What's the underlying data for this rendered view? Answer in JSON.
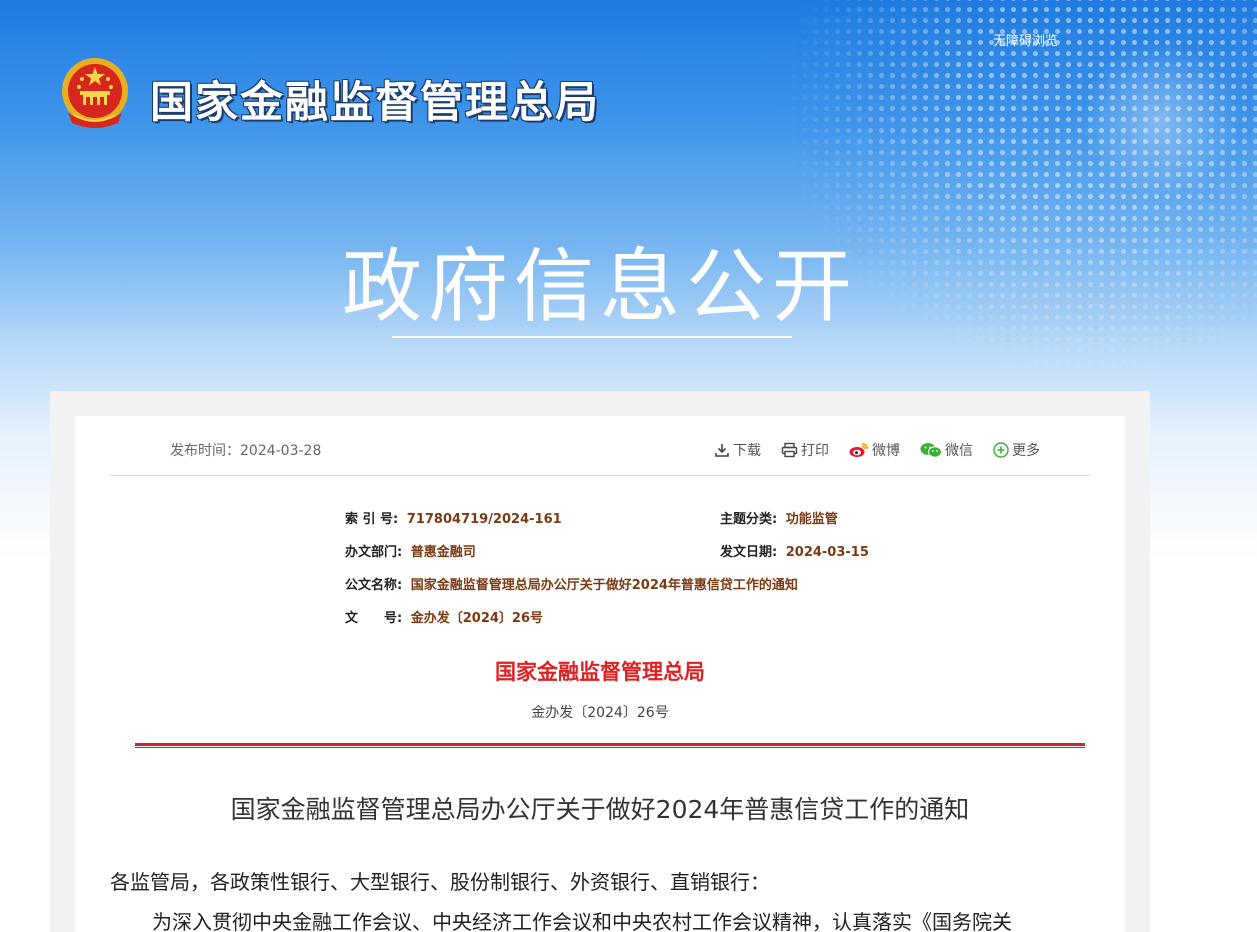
{
  "header": {
    "accessibility_link": "无障碍浏览",
    "org_name": "国家金融监督管理总局",
    "section_title": "政府信息公开"
  },
  "toolbar": {
    "publish_label": "发布时间：2024-03-28",
    "download": "下载",
    "print": "打印",
    "weibo": "微博",
    "wechat": "微信",
    "more": "更多"
  },
  "meta": {
    "index_label": "索 引 号:",
    "index_value": "717804719/2024-161",
    "topic_label": "主题分类:",
    "topic_value": "功能监管",
    "dept_label": "办文部门:",
    "dept_value": "普惠金融司",
    "date_label": "发文日期:",
    "date_value": "2024-03-15",
    "name_label": "公文名称:",
    "name_value": "国家金融监督管理总局办公厅关于做好2024年普惠信贷工作的通知",
    "number_label": "文　　号:",
    "number_value": "金办发〔2024〕26号"
  },
  "document": {
    "issuer": "国家金融监督管理总局",
    "doc_number": "金办发〔2024〕26号",
    "title": "国家金融监督管理总局办公厅关于做好2024年普惠信贷工作的通知",
    "salutation": "各监管局，各政策性银行、大型银行、股份制银行、外资银行、直销银行：",
    "first_paragraph": "为深入贯彻中央金融工作会议、中央经济工作会议和中央农村工作会议精神，认真落实《国务院关"
  },
  "colors": {
    "banner_blue": "#1f7be0",
    "doc_red": "#e02020",
    "meta_value": "#7a3a14"
  }
}
